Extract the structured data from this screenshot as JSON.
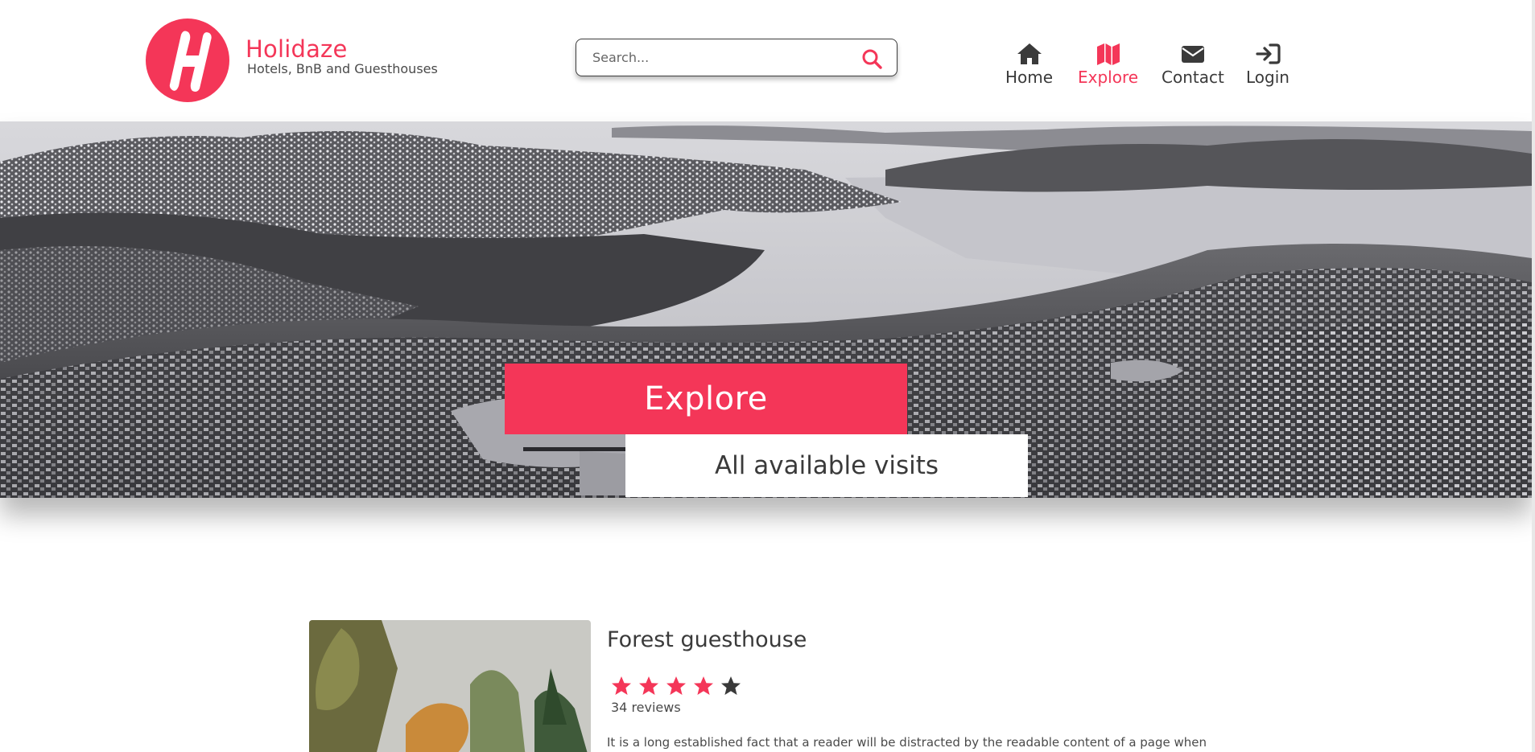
{
  "brand": {
    "name": "Holidaze",
    "tagline": "Hotels, BnB and Guesthouses",
    "accent_color": "#f43658"
  },
  "search": {
    "placeholder": "Search...",
    "icon": "search-icon"
  },
  "nav": {
    "items": [
      {
        "label": "Home",
        "icon": "home-icon",
        "active": false
      },
      {
        "label": "Explore",
        "icon": "map-icon",
        "active": true
      },
      {
        "label": "Contact",
        "icon": "envelope-icon",
        "active": false
      },
      {
        "label": "Login",
        "icon": "sign-in-icon",
        "active": false
      }
    ]
  },
  "hero": {
    "title": "Explore",
    "subtitle": "All available visits"
  },
  "listings": [
    {
      "title": "Forest guesthouse",
      "rating": 4,
      "rating_max": 5,
      "reviews": "34 reviews",
      "description": "It is a long established fact that a reader will be distracted by the readable content of a page when"
    }
  ]
}
